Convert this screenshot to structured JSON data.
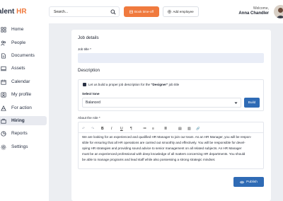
{
  "header": {
    "logo_prefix": "alent ",
    "logo_accent": "HR",
    "search_placeholder": "Search...",
    "book_timeoff_label": "Book time-off",
    "add_employee_label": "Add employee",
    "welcome_text": "Welcome,",
    "user_name": "Anna Chandler"
  },
  "sidebar": {
    "items": [
      {
        "label": "Home",
        "icon": "home-icon"
      },
      {
        "label": "People",
        "icon": "people-icon"
      },
      {
        "label": "Documents",
        "icon": "documents-icon"
      },
      {
        "label": "Assets",
        "icon": "assets-icon"
      },
      {
        "label": "Calendar",
        "icon": "calendar-icon"
      },
      {
        "label": "My profile",
        "icon": "profile-icon"
      },
      {
        "label": "For action",
        "icon": "action-icon"
      },
      {
        "label": "Hiring",
        "icon": "hiring-icon",
        "active": true
      },
      {
        "label": "Reports",
        "icon": "reports-icon"
      },
      {
        "label": "Settings",
        "icon": "settings-icon"
      }
    ]
  },
  "job_details": {
    "title": "Job details",
    "job_title_label": "Job title *",
    "job_title_value": ""
  },
  "description": {
    "title": "Description",
    "checkbox_text_pre": "Let us build a proper job description for the ",
    "checkbox_text_bold": "\"Designer\"",
    "checkbox_text_post": " job title",
    "select_tone_label": "Select tone",
    "tone_value": "Balanced",
    "build_label": "Build"
  },
  "about_role": {
    "label": "About the role *",
    "toolbar": [
      "↶",
      "↷",
      "B",
      "I",
      "U",
      "¶",
      "≔",
      "≡",
      "≣",
      "▤",
      "▥",
      "🔗"
    ],
    "lines": [
      "We are looking for an experienced and qualified HR Manager to join our team. As an HR Manager, you will be respon-",
      "sible for ensuring that all HR operations are carried out smoothly and effectively. You will be responsible for devel-",
      "oping HR strategies and providing sound advice to senior management on all related subjects. An HR Manager",
      "must be an experienced professional with deep knowledge of all matters concerning HR departments. You should",
      "be able to manage programs and lead staff while also possessing a strong strategic mindset."
    ]
  },
  "publish_label": "Publish",
  "colors": {
    "accent_orange": "#f07a3e",
    "primary_blue": "#2f6bb5",
    "sidebar_active": "#e8eaf0",
    "main_bg": "#eceef2"
  }
}
